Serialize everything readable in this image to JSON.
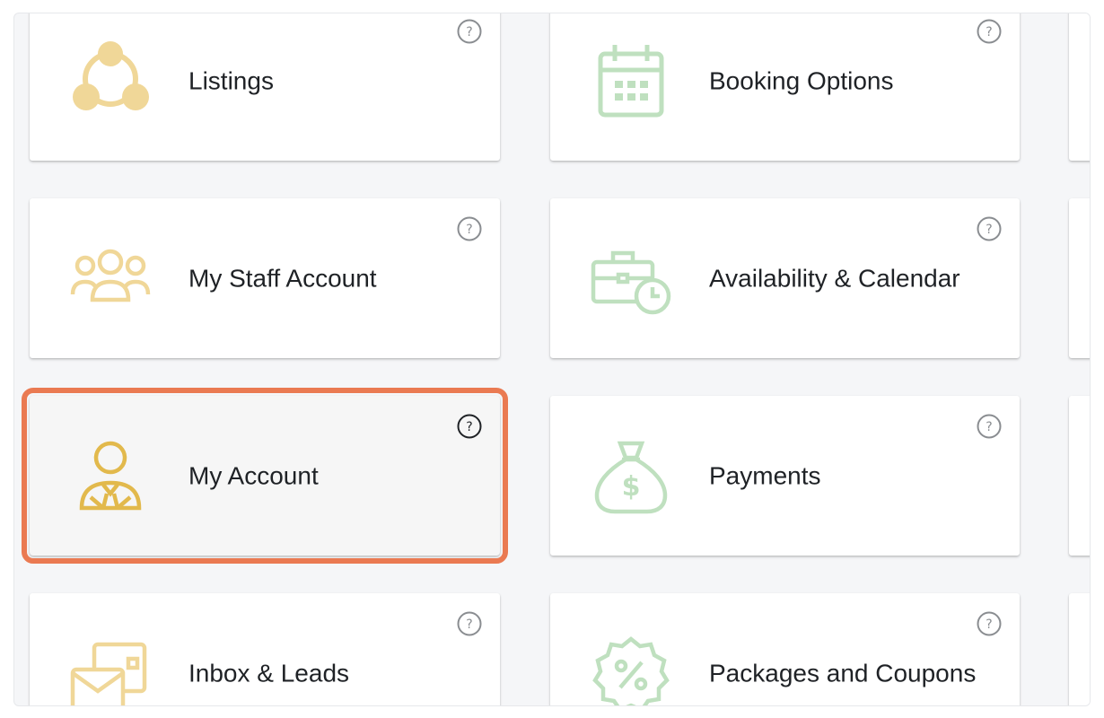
{
  "colors": {
    "accent_orange": "#ea7a52",
    "icon_yellow": "#f0d798",
    "icon_yellow_active": "#e2b94c",
    "icon_green": "#bfe0bf",
    "help_gray": "#8a8d91"
  },
  "tiles": {
    "listings": {
      "label": "Listings",
      "icon": "network-icon"
    },
    "booking_options": {
      "label": "Booking Options",
      "icon": "calendar-icon"
    },
    "my_staff_account": {
      "label": "My Staff Account",
      "icon": "users-group-icon"
    },
    "availability_calendar": {
      "label": "Availability & Calendar",
      "icon": "briefcase-clock-icon"
    },
    "my_account": {
      "label": "My Account",
      "icon": "user-tie-icon",
      "selected": true
    },
    "payments": {
      "label": "Payments",
      "icon": "money-bag-icon"
    },
    "inbox_leads": {
      "label": "Inbox & Leads",
      "icon": "envelope-card-icon"
    },
    "packages_coupons": {
      "label": "Packages and Coupons",
      "icon": "percent-badge-icon"
    }
  },
  "help_icon": "question-circle-icon"
}
